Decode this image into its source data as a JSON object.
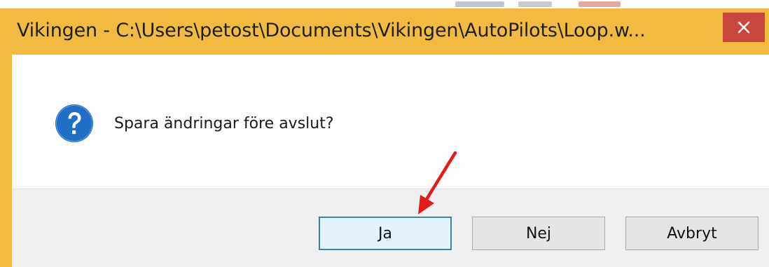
{
  "window": {
    "title": "Vikingen - C:\\Users\\petost\\Documents\\Vikingen\\AutoPilots\\Loop.w...",
    "close_glyph": "✕",
    "titlebar_color": "#f3ba42",
    "close_color": "#c9463d"
  },
  "dialog": {
    "icon": "question-icon",
    "icon_color": "#1f6fc5",
    "message": "Spara ändringar före avslut?"
  },
  "buttons": {
    "yes_label": "Ja",
    "no_label": "Nej",
    "cancel_label": "Avbryt",
    "default_button": "Ja",
    "default_border_color": "#3c7fb1"
  },
  "annotation": {
    "icon": "red-arrow-icon",
    "color": "#e21b1b",
    "points_to": "Ja"
  }
}
